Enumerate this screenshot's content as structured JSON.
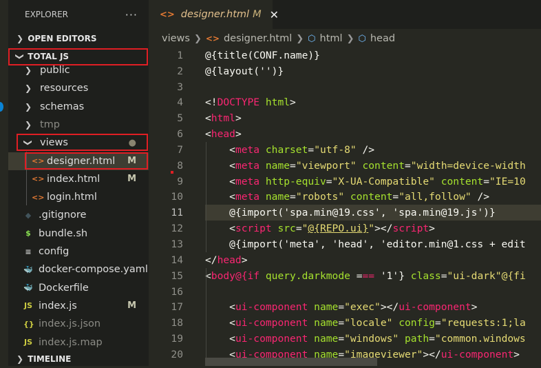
{
  "sidebar": {
    "title": "EXPLORER",
    "more_label": "···",
    "open_editors": "OPEN EDITORS",
    "root": "TOTAL JS",
    "timeline": "TIMELINE",
    "items": [
      {
        "label": "public",
        "kind": "folder",
        "icon": "chevron-right"
      },
      {
        "label": "resources",
        "kind": "folder",
        "icon": "chevron-right"
      },
      {
        "label": "schemas",
        "kind": "folder",
        "icon": "chevron-right"
      },
      {
        "label": "tmp",
        "kind": "folder",
        "icon": "chevron-right",
        "dim": true
      },
      {
        "label": "views",
        "kind": "folder-open",
        "icon": "chevron-down",
        "badge": "●"
      },
      {
        "label": "designer.html",
        "kind": "html",
        "icon": "html-icon",
        "badge": "M",
        "selected": true,
        "nested": true
      },
      {
        "label": "index.html",
        "kind": "html",
        "icon": "html-icon",
        "badge": "M",
        "nested": true
      },
      {
        "label": "login.html",
        "kind": "html",
        "icon": "html-icon",
        "nested": true
      },
      {
        "label": ".gitignore",
        "kind": "git",
        "icon": "git-icon"
      },
      {
        "label": "bundle.sh",
        "kind": "shell",
        "icon": "shell-icon"
      },
      {
        "label": "config",
        "kind": "text",
        "icon": "lines-icon"
      },
      {
        "label": "docker-compose.yaml",
        "kind": "docker-pink",
        "icon": "docker-icon"
      },
      {
        "label": "Dockerfile",
        "kind": "docker",
        "icon": "docker-icon"
      },
      {
        "label": "index.js",
        "kind": "js",
        "icon": "js-icon",
        "badge": "M"
      },
      {
        "label": "index.js.json",
        "kind": "json",
        "icon": "json-icon",
        "dim": true
      },
      {
        "label": "index.js.map",
        "kind": "js",
        "icon": "js-icon",
        "dim": true
      }
    ]
  },
  "tab": {
    "name": "designer.html",
    "modified": "M",
    "close": "✕"
  },
  "breadcrumb": [
    "views",
    "designer.html",
    "html",
    "head"
  ],
  "editor": {
    "current_line": 11,
    "lines": [
      [
        [
          "p",
          "@{title(CONF.name)}"
        ]
      ],
      [
        [
          "p",
          "@{layout('')}"
        ]
      ],
      [],
      [
        [
          "p",
          "<!"
        ],
        [
          "t",
          "DOCTYPE"
        ],
        [
          "a",
          " html"
        ],
        [
          "p",
          ">"
        ]
      ],
      [
        [
          "p",
          "<"
        ],
        [
          "t",
          "html"
        ],
        [
          "p",
          ">"
        ]
      ],
      [
        [
          "p",
          "<"
        ],
        [
          "t",
          "head"
        ],
        [
          "p",
          ">"
        ]
      ],
      [
        [
          "p",
          "    <"
        ],
        [
          "t",
          "meta"
        ],
        [
          "a",
          " charset"
        ],
        [
          "p",
          "="
        ],
        [
          "s",
          "\"utf-8\""
        ],
        [
          "p",
          " />"
        ]
      ],
      [
        [
          "p",
          "    <"
        ],
        [
          "t",
          "meta"
        ],
        [
          "a",
          " name"
        ],
        [
          "p",
          "="
        ],
        [
          "s",
          "\"viewport\""
        ],
        [
          "a",
          " content"
        ],
        [
          "p",
          "="
        ],
        [
          "s",
          "\"width=device-width"
        ]
      ],
      [
        [
          "p",
          "    <"
        ],
        [
          "t",
          "meta"
        ],
        [
          "a",
          " http-equiv"
        ],
        [
          "p",
          "="
        ],
        [
          "s",
          "\"X-UA-Compatible\""
        ],
        [
          "a",
          " content"
        ],
        [
          "p",
          "="
        ],
        [
          "s",
          "\"IE=10"
        ]
      ],
      [
        [
          "p",
          "    <"
        ],
        [
          "t",
          "meta"
        ],
        [
          "a",
          " name"
        ],
        [
          "p",
          "="
        ],
        [
          "s",
          "\"robots\""
        ],
        [
          "a",
          " content"
        ],
        [
          "p",
          "="
        ],
        [
          "s",
          "\"all,follow\""
        ],
        [
          "p",
          " />"
        ]
      ],
      [
        [
          "p",
          "    @{import('spa.min@19.css', 'spa.min@19.js')}"
        ]
      ],
      [
        [
          "p",
          "    <"
        ],
        [
          "t",
          "script"
        ],
        [
          "a",
          " src"
        ],
        [
          "p",
          "="
        ],
        [
          "s",
          "\""
        ],
        [
          "u",
          "@{REPO.ui}"
        ],
        [
          "s",
          "\""
        ],
        [
          "p",
          "></"
        ],
        [
          "t",
          "script"
        ],
        [
          "p",
          ">"
        ]
      ],
      [
        [
          "p",
          "    @{import('meta', 'head', 'editor.min@1.css + edit"
        ]
      ],
      [
        [
          "p",
          "</"
        ],
        [
          "t",
          "head"
        ],
        [
          "p",
          ">"
        ]
      ],
      [
        [
          "p",
          "<"
        ],
        [
          "t",
          "body@{if"
        ],
        [
          "a",
          " query.darkmode "
        ],
        [
          "p",
          "="
        ],
        [
          "t",
          "=="
        ],
        [
          "p",
          " '1'} "
        ],
        [
          "a",
          "class"
        ],
        [
          "p",
          "="
        ],
        [
          "s",
          "\"ui-dark\"@{fi"
        ]
      ],
      [],
      [
        [
          "p",
          "    <"
        ],
        [
          "t",
          "ui-component"
        ],
        [
          "a",
          " name"
        ],
        [
          "p",
          "="
        ],
        [
          "s",
          "\"exec\""
        ],
        [
          "p",
          "></"
        ],
        [
          "t",
          "ui-component"
        ],
        [
          "p",
          ">"
        ]
      ],
      [
        [
          "p",
          "    <"
        ],
        [
          "t",
          "ui-component"
        ],
        [
          "a",
          " name"
        ],
        [
          "p",
          "="
        ],
        [
          "s",
          "\"locale\""
        ],
        [
          "a",
          " config"
        ],
        [
          "p",
          "="
        ],
        [
          "s",
          "\"requests:1;la"
        ]
      ],
      [
        [
          "p",
          "    <"
        ],
        [
          "t",
          "ui-component"
        ],
        [
          "a",
          " name"
        ],
        [
          "p",
          "="
        ],
        [
          "s",
          "\"windows\""
        ],
        [
          "a",
          " path"
        ],
        [
          "p",
          "="
        ],
        [
          "s",
          "\"common.windows"
        ]
      ],
      [
        [
          "p",
          "    <"
        ],
        [
          "t",
          "ui-component"
        ],
        [
          "a",
          " name"
        ],
        [
          "p",
          "="
        ],
        [
          "s",
          "\"imageviewer\""
        ],
        [
          "p",
          "></"
        ],
        [
          "t",
          "ui-component"
        ],
        [
          "p",
          ">"
        ]
      ]
    ]
  },
  "colors": {
    "tag": "#f92672",
    "attr": "#a6e22e",
    "string": "#e6db74",
    "text": "#f8f8f2",
    "bg": "#272822",
    "highlight": "#e01e24"
  }
}
